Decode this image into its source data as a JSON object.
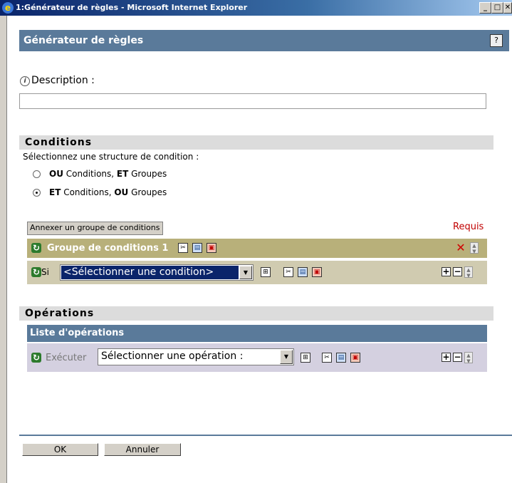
{
  "window": {
    "title": "1:Générateur de règles - Microsoft Internet Explorer",
    "minimize": "_",
    "maximize": "□",
    "close": "✕"
  },
  "header": {
    "title": "Générateur de règles",
    "help": "?"
  },
  "description": {
    "label": "Description :",
    "value": ""
  },
  "conditions": {
    "section_title": "Conditions",
    "prompt": "Sélectionnez une structure de condition :",
    "options": [
      {
        "b1": "OU",
        "t1": " Conditions, ",
        "b2": "ET",
        "t2": " Groupes",
        "checked": false
      },
      {
        "b1": "ET",
        "t1": " Conditions, ",
        "b2": "OU",
        "t2": " Groupes",
        "checked": true
      }
    ],
    "annex_button": "Annexer un groupe de conditions",
    "required": "Requis",
    "group_title": "Groupe de conditions 1",
    "si_label": "Si",
    "condition_value": "<Sélectionner une condition>"
  },
  "operations": {
    "section_title": "Opérations",
    "list_title": "Liste d'opérations",
    "execute_label": "Exécuter",
    "operation_value": "Sélectionner une opération :"
  },
  "footer": {
    "ok": "OK",
    "cancel": "Annuler"
  },
  "colors": {
    "titlebar": "#0a246a",
    "header": "#5a7a9a",
    "group_header": "#b8b07a",
    "group_row": "#d0cbb0",
    "ops_row": "#d4d0e0",
    "required": "#c00000"
  }
}
